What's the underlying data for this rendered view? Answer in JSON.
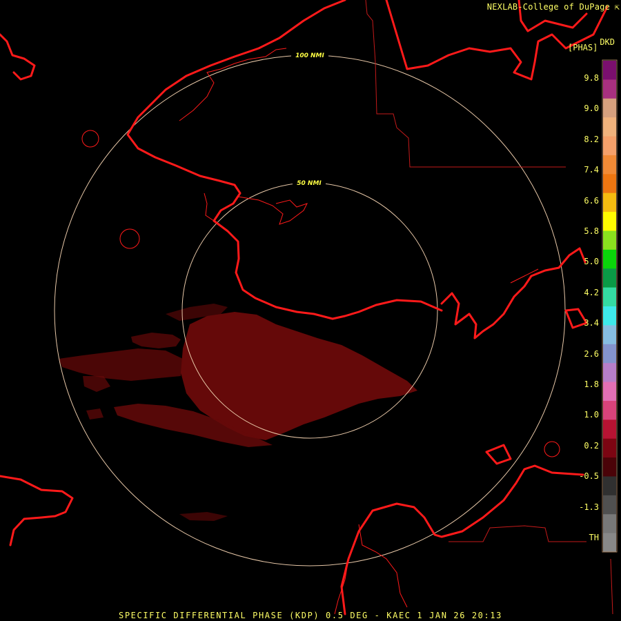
{
  "credit": "NEXLAB-College of DuPage",
  "credit_icon": "arrow-corner-icon",
  "legend": {
    "product_code": "DKD",
    "units": "[PHAS]",
    "ticks": [
      "9.8",
      "9.0",
      "8.2",
      "7.4",
      "6.6",
      "5.8",
      "5.0",
      "4.2",
      "3.4",
      "2.6",
      "1.8",
      "1.0",
      "0.2",
      "-0.5",
      "-1.3",
      "TH"
    ],
    "colors": [
      "#7a0f6e",
      "#a8307f",
      "#d6a07e",
      "#f0b27c",
      "#f5a06a",
      "#f18a36",
      "#ee7611",
      "#f6bb10",
      "#fffb00",
      "#8ae01e",
      "#0ad40a",
      "#0a9a46",
      "#34dba2",
      "#3ee9e9",
      "#87bde0",
      "#8493cc",
      "#b77ec8",
      "#e26fb4",
      "#d7437a",
      "#b61332",
      "#7c0512",
      "#4a0308",
      "#303030",
      "#505050",
      "#787878",
      "#888888"
    ]
  },
  "rings": {
    "inner_label": "50 NMI",
    "outer_label": "100 NMI"
  },
  "footer": "SPECIFIC DIFFERENTIAL PHASE (KDP) 0.5 DEG - KAEC 1 JAN 26 20:13",
  "colors": {
    "coastline": "#ff1a1a",
    "boundary": "#c41a1a",
    "ring": "#e8c8a8",
    "echo": "#6b0a0a",
    "text": "#ffff66"
  }
}
